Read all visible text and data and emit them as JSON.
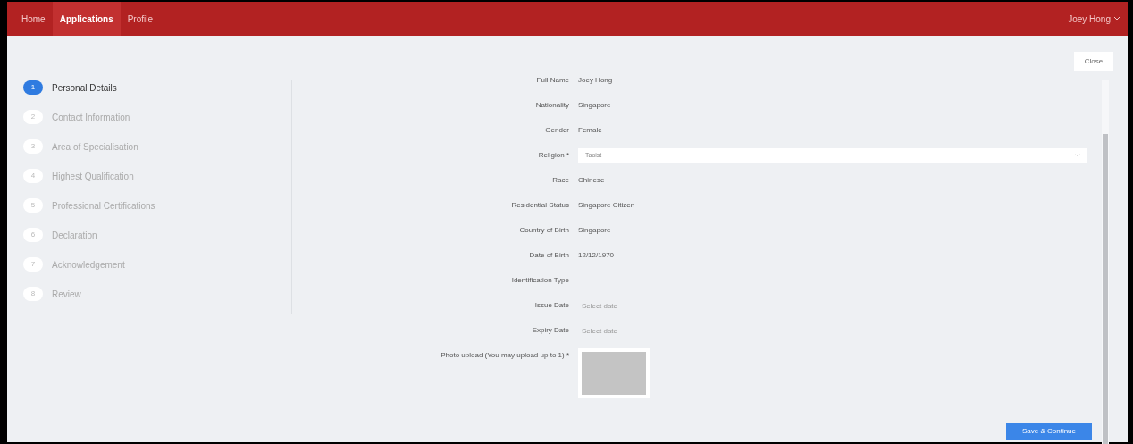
{
  "navbar": {
    "tabs": [
      {
        "label": "Home",
        "selected": false
      },
      {
        "label": "Applications",
        "selected": true
      },
      {
        "label": "Profile",
        "selected": false
      }
    ],
    "user": "Joey Hong"
  },
  "close_button": "Close",
  "steps": [
    {
      "number": "1",
      "label": "Personal Details",
      "selected": true
    },
    {
      "number": "2",
      "label": "Contact Information",
      "selected": false
    },
    {
      "number": "3",
      "label": "Area of Specialisation",
      "selected": false
    },
    {
      "number": "4",
      "label": "Highest Qualification",
      "selected": false
    },
    {
      "number": "5",
      "label": "Professional Certifications",
      "selected": false
    },
    {
      "number": "6",
      "label": "Declaration",
      "selected": false
    },
    {
      "number": "7",
      "label": "Acknowledgement",
      "selected": false
    },
    {
      "number": "8",
      "label": "Review",
      "selected": false
    }
  ],
  "fields": [
    {
      "kind": "text",
      "label": "Full Name",
      "value": "Joey Hong"
    },
    {
      "kind": "text",
      "label": "Nationality",
      "value": "Singapore"
    },
    {
      "kind": "text",
      "label": "Gender",
      "value": "Female"
    },
    {
      "kind": "select",
      "label": "Religion *",
      "value": "Taoist"
    },
    {
      "kind": "text",
      "label": "Race",
      "value": "Chinese"
    },
    {
      "kind": "text",
      "label": "Residential Status",
      "value": "Singapore Citizen"
    },
    {
      "kind": "text",
      "label": "Country of Birth",
      "value": "Singapore"
    },
    {
      "kind": "text",
      "label": "Date of Birth",
      "value": "12/12/1970"
    },
    {
      "kind": "text",
      "label": "Identification Type"
    },
    {
      "kind": "date",
      "label": "Issue Date",
      "placeholder": "Select date"
    },
    {
      "kind": "date",
      "label": "Expiry Date",
      "placeholder": "Select date"
    },
    {
      "kind": "upload",
      "label": "Photo upload (You may upload up to 1) *"
    }
  ],
  "save_button": "Save & Continue"
}
